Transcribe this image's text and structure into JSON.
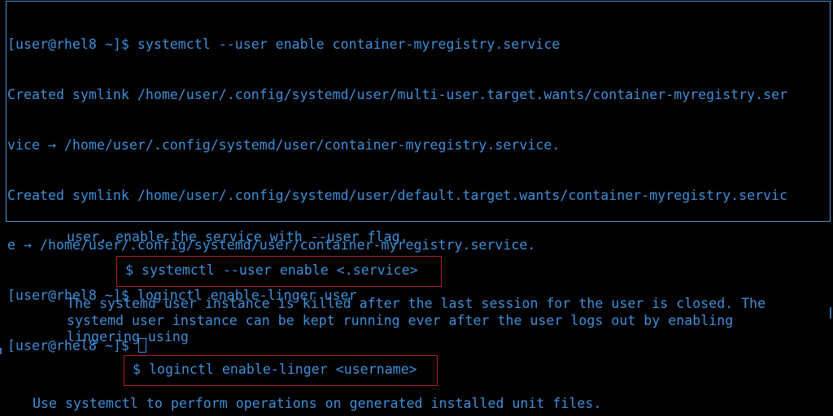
{
  "terminal": {
    "lines": [
      "[user@rhel8 ~]$ systemctl --user enable container-myregistry.service",
      "Created symlink /home/user/.config/systemd/user/multi-user.target.wants/container-myregistry.ser",
      "vice → /home/user/.config/systemd/user/container-myregistry.service.",
      "Created symlink /home/user/.config/systemd/user/default.target.wants/container-myregistry.servic",
      "e → /home/user/.config/systemd/user/container-myregistry.service.",
      "[user@rhel8 ~]$ loginctl enable-linger user"
    ],
    "prompt": "[user@rhel8 ~]$ "
  },
  "doc": {
    "line1": "user, enable the service with --user flag.",
    "cmd1": "$ systemctl --user enable <.service>",
    "para_line1": "The systemd user instance is killed after the last session for the user is closed. The",
    "para_line2": "systemd user instance can be kept running ever after the user logs out by enabling",
    "para_line3": "lingering using",
    "cmd2": "$ loginctl enable-linger <username>",
    "line_last": "Use systemctl to perform operations on generated installed unit files."
  },
  "colors": {
    "text": "#3f8fd9",
    "border": "#4a8fd0",
    "highlight_box": "#b0232a",
    "background": "#000000"
  }
}
